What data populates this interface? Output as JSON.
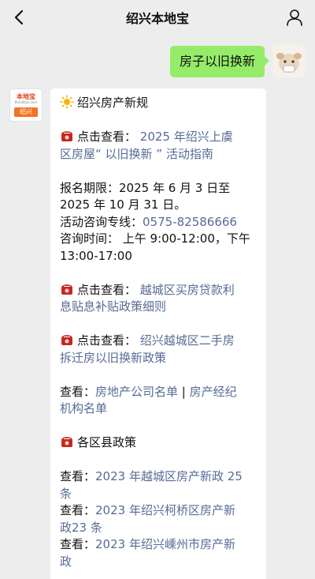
{
  "header": {
    "title": "绍兴本地宝",
    "back_icon": "chevron-left-icon",
    "profile_icon": "person-icon"
  },
  "outgoing": {
    "text": "房子以旧换新",
    "bubble_color": "#95ec69"
  },
  "brand_avatar": {
    "logo_text": "本地宝",
    "logo_url": "Bendibao.com",
    "city_tag": "绍兴"
  },
  "message": {
    "heading": "绍兴房产新规",
    "link1_prefix": "点击查看：",
    "link1_text_a": "2025 年绍兴上虞",
    "link1_text_b": "区房屋“ 以旧换新 ” 活动指南",
    "info_line1": "报名期限：2025 年 6 月 3 日至",
    "info_line2": "2025 年 10 月 31 日。",
    "info_line3_label": "活动咨询专线：",
    "info_line3_phone": "0575-82586666",
    "info_line4": "咨询时间：  上午 9:00-12:00，下午",
    "info_line5": "13:00-17:00",
    "link2_prefix": "点击查看：",
    "link2_text_a": "越城区买房贷款利",
    "link2_text_b": "息贴息补贴政策细则",
    "link3_prefix": "点击查看：",
    "link3_text_a": "绍兴越城区二手房",
    "link3_text_b": "拆迁房以旧换新政策",
    "see_label": "查看：",
    "see_link_a": "房地产公司名单",
    "see_sep": " | ",
    "see_link_b1": "房产经纪",
    "see_link_b2": "机构名单",
    "district_heading": "各区县政策",
    "d1_label": "查看：",
    "d1_a": "2023 年越城区房产新政 25",
    "d1_b": "条",
    "d2_label": "查看：",
    "d2_a": "2023 年绍兴柯桥区房产新",
    "d2_b": "政23 条",
    "d3_label": "查看：",
    "d3_a": "2023 年绍兴嵊州市房产新",
    "d3_b": "政",
    "link_color": "#576b95",
    "heading_icon": "sun-icon",
    "phone_icon": "telephone-icon"
  }
}
